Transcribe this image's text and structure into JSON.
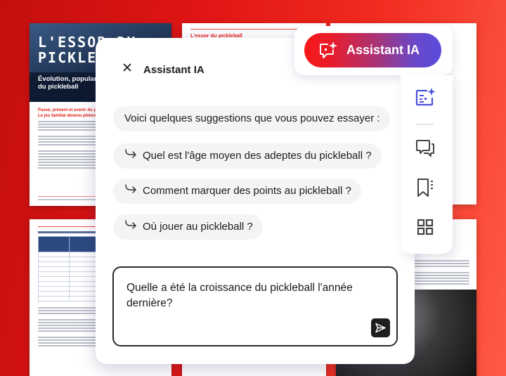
{
  "background_document": {
    "cover_title": "L'ESSOR DU\nPICKLEBALL",
    "cover_subtitle": "Évolution, popularité et impact mondial du pickleball",
    "cover_headings": [
      "Passé, présent et avenir du pickleball",
      "Le jeu familial devenu phénomène"
    ],
    "page2_title": "L'essor du pickleball"
  },
  "assistant_toolbar": {
    "button_label": "Assistant IA",
    "button_icon": "ai-chat-sparkle-icon",
    "gradient_start": "#f81818",
    "gradient_end": "#5a4cdc"
  },
  "side_rail": {
    "items": [
      {
        "name": "ai-summary",
        "icon": "ai-document-sparkle-icon",
        "active": true,
        "color": "#4b52d9"
      },
      {
        "name": "comments",
        "icon": "comments-icon",
        "active": false
      },
      {
        "name": "bookmarks",
        "icon": "bookmark-list-icon",
        "active": false
      },
      {
        "name": "thumbnails",
        "icon": "grid-icon",
        "active": false
      }
    ]
  },
  "panel": {
    "title": "Assistant IA",
    "close_icon": "close-icon",
    "intro": "Voici quelques suggestions que vous pouvez essayer :",
    "suggestions": [
      {
        "icon": "arrow-return-right-icon",
        "label": "Quel est l'âge moyen des adeptes du pickleball ?"
      },
      {
        "icon": "arrow-return-right-icon",
        "label": "Comment marquer des points au pickleball ?"
      },
      {
        "icon": "arrow-return-right-icon",
        "label": "Où jouer au pickleball ?"
      }
    ],
    "prompt": {
      "value": "Quelle a été la croissance du pickleball l'année dernière?",
      "send_icon": "send-icon"
    }
  }
}
